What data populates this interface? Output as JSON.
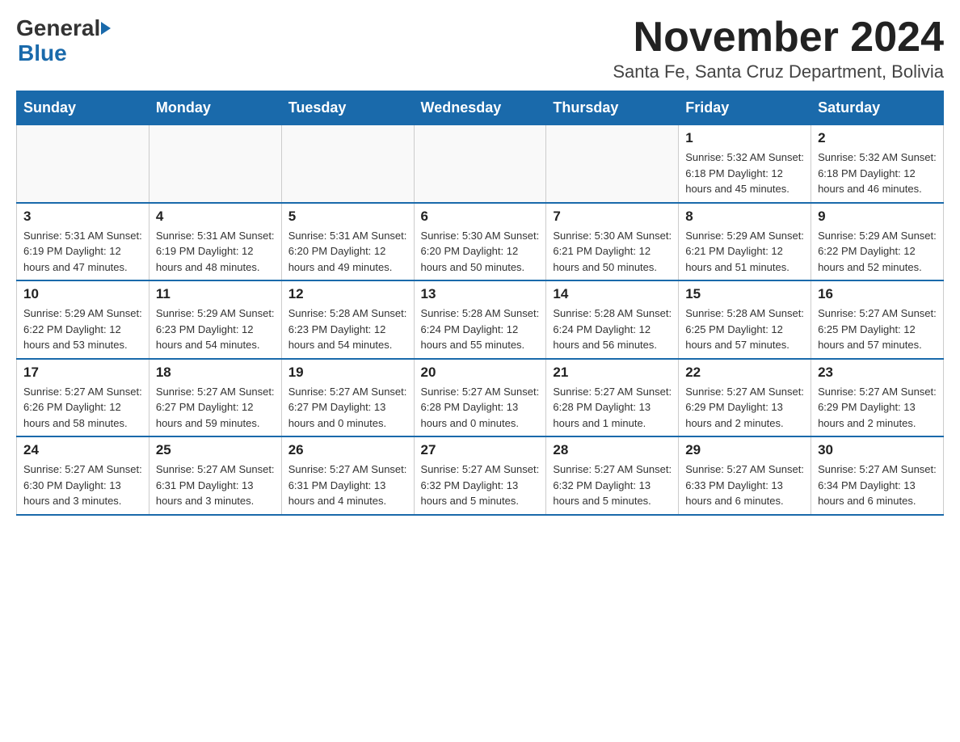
{
  "logo": {
    "general": "General",
    "blue": "Blue"
  },
  "title": "November 2024",
  "subtitle": "Santa Fe, Santa Cruz Department, Bolivia",
  "weekdays": [
    "Sunday",
    "Monday",
    "Tuesday",
    "Wednesday",
    "Thursday",
    "Friday",
    "Saturday"
  ],
  "weeks": [
    [
      {
        "day": "",
        "info": ""
      },
      {
        "day": "",
        "info": ""
      },
      {
        "day": "",
        "info": ""
      },
      {
        "day": "",
        "info": ""
      },
      {
        "day": "",
        "info": ""
      },
      {
        "day": "1",
        "info": "Sunrise: 5:32 AM\nSunset: 6:18 PM\nDaylight: 12 hours and 45 minutes."
      },
      {
        "day": "2",
        "info": "Sunrise: 5:32 AM\nSunset: 6:18 PM\nDaylight: 12 hours and 46 minutes."
      }
    ],
    [
      {
        "day": "3",
        "info": "Sunrise: 5:31 AM\nSunset: 6:19 PM\nDaylight: 12 hours and 47 minutes."
      },
      {
        "day": "4",
        "info": "Sunrise: 5:31 AM\nSunset: 6:19 PM\nDaylight: 12 hours and 48 minutes."
      },
      {
        "day": "5",
        "info": "Sunrise: 5:31 AM\nSunset: 6:20 PM\nDaylight: 12 hours and 49 minutes."
      },
      {
        "day": "6",
        "info": "Sunrise: 5:30 AM\nSunset: 6:20 PM\nDaylight: 12 hours and 50 minutes."
      },
      {
        "day": "7",
        "info": "Sunrise: 5:30 AM\nSunset: 6:21 PM\nDaylight: 12 hours and 50 minutes."
      },
      {
        "day": "8",
        "info": "Sunrise: 5:29 AM\nSunset: 6:21 PM\nDaylight: 12 hours and 51 minutes."
      },
      {
        "day": "9",
        "info": "Sunrise: 5:29 AM\nSunset: 6:22 PM\nDaylight: 12 hours and 52 minutes."
      }
    ],
    [
      {
        "day": "10",
        "info": "Sunrise: 5:29 AM\nSunset: 6:22 PM\nDaylight: 12 hours and 53 minutes."
      },
      {
        "day": "11",
        "info": "Sunrise: 5:29 AM\nSunset: 6:23 PM\nDaylight: 12 hours and 54 minutes."
      },
      {
        "day": "12",
        "info": "Sunrise: 5:28 AM\nSunset: 6:23 PM\nDaylight: 12 hours and 54 minutes."
      },
      {
        "day": "13",
        "info": "Sunrise: 5:28 AM\nSunset: 6:24 PM\nDaylight: 12 hours and 55 minutes."
      },
      {
        "day": "14",
        "info": "Sunrise: 5:28 AM\nSunset: 6:24 PM\nDaylight: 12 hours and 56 minutes."
      },
      {
        "day": "15",
        "info": "Sunrise: 5:28 AM\nSunset: 6:25 PM\nDaylight: 12 hours and 57 minutes."
      },
      {
        "day": "16",
        "info": "Sunrise: 5:27 AM\nSunset: 6:25 PM\nDaylight: 12 hours and 57 minutes."
      }
    ],
    [
      {
        "day": "17",
        "info": "Sunrise: 5:27 AM\nSunset: 6:26 PM\nDaylight: 12 hours and 58 minutes."
      },
      {
        "day": "18",
        "info": "Sunrise: 5:27 AM\nSunset: 6:27 PM\nDaylight: 12 hours and 59 minutes."
      },
      {
        "day": "19",
        "info": "Sunrise: 5:27 AM\nSunset: 6:27 PM\nDaylight: 13 hours and 0 minutes."
      },
      {
        "day": "20",
        "info": "Sunrise: 5:27 AM\nSunset: 6:28 PM\nDaylight: 13 hours and 0 minutes."
      },
      {
        "day": "21",
        "info": "Sunrise: 5:27 AM\nSunset: 6:28 PM\nDaylight: 13 hours and 1 minute."
      },
      {
        "day": "22",
        "info": "Sunrise: 5:27 AM\nSunset: 6:29 PM\nDaylight: 13 hours and 2 minutes."
      },
      {
        "day": "23",
        "info": "Sunrise: 5:27 AM\nSunset: 6:29 PM\nDaylight: 13 hours and 2 minutes."
      }
    ],
    [
      {
        "day": "24",
        "info": "Sunrise: 5:27 AM\nSunset: 6:30 PM\nDaylight: 13 hours and 3 minutes."
      },
      {
        "day": "25",
        "info": "Sunrise: 5:27 AM\nSunset: 6:31 PM\nDaylight: 13 hours and 3 minutes."
      },
      {
        "day": "26",
        "info": "Sunrise: 5:27 AM\nSunset: 6:31 PM\nDaylight: 13 hours and 4 minutes."
      },
      {
        "day": "27",
        "info": "Sunrise: 5:27 AM\nSunset: 6:32 PM\nDaylight: 13 hours and 5 minutes."
      },
      {
        "day": "28",
        "info": "Sunrise: 5:27 AM\nSunset: 6:32 PM\nDaylight: 13 hours and 5 minutes."
      },
      {
        "day": "29",
        "info": "Sunrise: 5:27 AM\nSunset: 6:33 PM\nDaylight: 13 hours and 6 minutes."
      },
      {
        "day": "30",
        "info": "Sunrise: 5:27 AM\nSunset: 6:34 PM\nDaylight: 13 hours and 6 minutes."
      }
    ]
  ]
}
